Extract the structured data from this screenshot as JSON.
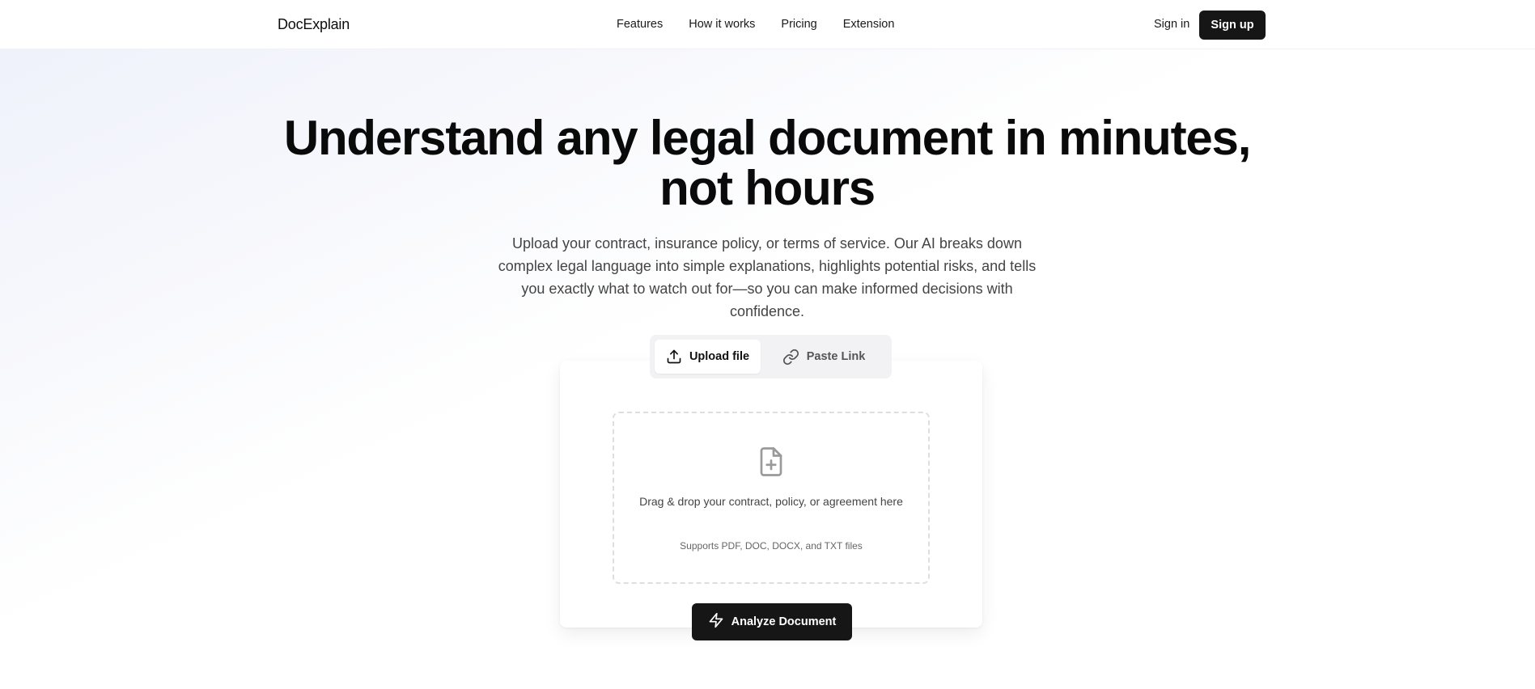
{
  "header": {
    "logo": "DocExplain",
    "nav": [
      "Features",
      "How it works",
      "Pricing",
      "Extension"
    ],
    "signin_label": "Sign in",
    "signup_label": "Sign up"
  },
  "hero": {
    "title_line1": "Understand any legal document in minutes,",
    "title_line2": "not hours",
    "subtitle": "Upload your contract, insurance policy, or terms of service. Our AI breaks down complex legal language into simple explanations, highlights potential risks, and tells you exactly what to watch out for—so you can make informed decisions with confidence."
  },
  "tabs": {
    "upload_label": "Upload file",
    "paste_label": "Paste Link",
    "active": "upload"
  },
  "dropzone": {
    "text": "Drag & drop your contract, policy, or agreement here",
    "hint": "Supports PDF, DOC, DOCX, and TXT files"
  },
  "actions": {
    "analyze_label": "Analyze Document"
  },
  "icons": {
    "upload": "upload-icon",
    "link": "link-icon",
    "file": "file-plus-icon",
    "analyze": "lightning-icon"
  },
  "colors": {
    "primary_button": "#161616",
    "text": "#111111",
    "muted_text": "#444444"
  }
}
